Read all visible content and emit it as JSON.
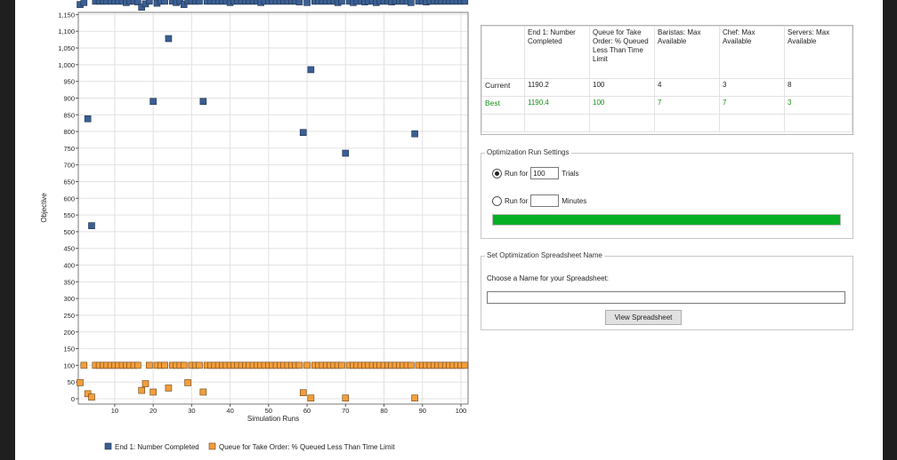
{
  "chart_data": {
    "type": "scatter",
    "xlabel": "Simulation Runs",
    "ylabel": "Objective",
    "xlim": [
      0,
      101
    ],
    "ylim": [
      0,
      1190
    ],
    "x_ticks": [
      10,
      20,
      30,
      40,
      50,
      60,
      70,
      80,
      90,
      100
    ],
    "y_ticks": [
      0,
      50,
      100,
      150,
      200,
      250,
      300,
      350,
      400,
      450,
      500,
      550,
      600,
      650,
      700,
      750,
      800,
      850,
      900,
      950,
      1000,
      1050,
      1100,
      1150
    ],
    "y_tick_labels": [
      "0",
      "50",
      "100",
      "150",
      "200",
      "250",
      "300",
      "350",
      "400",
      "450",
      "500",
      "550",
      "600",
      "650",
      "700",
      "750",
      "800",
      "850",
      "900",
      "950",
      "1,000",
      "1,050",
      "1,100",
      "1,150"
    ],
    "grid": true,
    "legend_position": "bottom",
    "series": [
      {
        "name": "End 1: Number Completed",
        "color": "#3a5f94",
        "points": [
          [
            1,
            1180
          ],
          [
            2,
            1186
          ],
          [
            3,
            838
          ],
          [
            4,
            518
          ],
          [
            5,
            1190
          ],
          [
            6,
            1190
          ],
          [
            7,
            1190
          ],
          [
            8,
            1190
          ],
          [
            9,
            1190
          ],
          [
            10,
            1190
          ],
          [
            11,
            1190
          ],
          [
            12,
            1190
          ],
          [
            13,
            1186
          ],
          [
            14,
            1190
          ],
          [
            15,
            1190
          ],
          [
            16,
            1188
          ],
          [
            17,
            1172
          ],
          [
            18,
            1182
          ],
          [
            19,
            1190
          ],
          [
            20,
            890
          ],
          [
            21,
            1184
          ],
          [
            22,
            1190
          ],
          [
            23,
            1190
          ],
          [
            24,
            1078
          ],
          [
            25,
            1190
          ],
          [
            26,
            1186
          ],
          [
            27,
            1190
          ],
          [
            28,
            1180
          ],
          [
            29,
            1190
          ],
          [
            30,
            1190
          ],
          [
            31,
            1190
          ],
          [
            32,
            1190
          ],
          [
            33,
            890
          ],
          [
            34,
            1190
          ],
          [
            35,
            1190
          ],
          [
            36,
            1190
          ],
          [
            37,
            1190
          ],
          [
            38,
            1190
          ],
          [
            39,
            1190
          ],
          [
            40,
            1186
          ],
          [
            41,
            1190
          ],
          [
            42,
            1190
          ],
          [
            43,
            1190
          ],
          [
            44,
            1190
          ],
          [
            45,
            1190
          ],
          [
            46,
            1190
          ],
          [
            47,
            1190
          ],
          [
            48,
            1186
          ],
          [
            49,
            1190
          ],
          [
            50,
            1190
          ],
          [
            51,
            1190
          ],
          [
            52,
            1190
          ],
          [
            53,
            1190
          ],
          [
            54,
            1190
          ],
          [
            55,
            1190
          ],
          [
            56,
            1190
          ],
          [
            57,
            1190
          ],
          [
            58,
            1188
          ],
          [
            59,
            797
          ],
          [
            60,
            1186
          ],
          [
            61,
            985
          ],
          [
            62,
            1190
          ],
          [
            63,
            1190
          ],
          [
            64,
            1190
          ],
          [
            65,
            1190
          ],
          [
            66,
            1190
          ],
          [
            67,
            1190
          ],
          [
            68,
            1186
          ],
          [
            69,
            1190
          ],
          [
            70,
            735
          ],
          [
            71,
            1190
          ],
          [
            72,
            1186
          ],
          [
            73,
            1190
          ],
          [
            74,
            1190
          ],
          [
            75,
            1188
          ],
          [
            76,
            1190
          ],
          [
            77,
            1190
          ],
          [
            78,
            1186
          ],
          [
            79,
            1190
          ],
          [
            80,
            1190
          ],
          [
            81,
            1190
          ],
          [
            82,
            1188
          ],
          [
            83,
            1190
          ],
          [
            84,
            1190
          ],
          [
            85,
            1190
          ],
          [
            86,
            1190
          ],
          [
            87,
            1186
          ],
          [
            88,
            793
          ],
          [
            89,
            1190
          ],
          [
            90,
            1190
          ],
          [
            91,
            1188
          ],
          [
            92,
            1190
          ],
          [
            93,
            1190
          ],
          [
            94,
            1190
          ],
          [
            95,
            1190
          ],
          [
            96,
            1190
          ],
          [
            97,
            1190
          ],
          [
            98,
            1190
          ],
          [
            99,
            1190
          ],
          [
            100,
            1190
          ],
          [
            101,
            1190
          ]
        ]
      },
      {
        "name": "Queue for Take Order: % Queued Less Than Time Limit",
        "color": "#f29e3c",
        "points": [
          [
            1,
            48
          ],
          [
            2,
            100
          ],
          [
            3,
            15
          ],
          [
            4,
            5
          ],
          [
            5,
            100
          ],
          [
            6,
            100
          ],
          [
            7,
            100
          ],
          [
            8,
            100
          ],
          [
            9,
            100
          ],
          [
            10,
            100
          ],
          [
            11,
            100
          ],
          [
            12,
            100
          ],
          [
            13,
            100
          ],
          [
            14,
            100
          ],
          [
            15,
            100
          ],
          [
            16,
            100
          ],
          [
            17,
            25
          ],
          [
            18,
            45
          ],
          [
            19,
            100
          ],
          [
            20,
            20
          ],
          [
            21,
            100
          ],
          [
            22,
            100
          ],
          [
            23,
            100
          ],
          [
            24,
            32
          ],
          [
            25,
            100
          ],
          [
            26,
            100
          ],
          [
            27,
            100
          ],
          [
            28,
            100
          ],
          [
            29,
            48
          ],
          [
            30,
            100
          ],
          [
            31,
            100
          ],
          [
            32,
            100
          ],
          [
            33,
            20
          ],
          [
            34,
            100
          ],
          [
            35,
            100
          ],
          [
            36,
            100
          ],
          [
            37,
            100
          ],
          [
            38,
            100
          ],
          [
            39,
            100
          ],
          [
            40,
            100
          ],
          [
            41,
            100
          ],
          [
            42,
            100
          ],
          [
            43,
            100
          ],
          [
            44,
            100
          ],
          [
            45,
            100
          ],
          [
            46,
            100
          ],
          [
            47,
            100
          ],
          [
            48,
            100
          ],
          [
            49,
            100
          ],
          [
            50,
            100
          ],
          [
            51,
            100
          ],
          [
            52,
            100
          ],
          [
            53,
            100
          ],
          [
            54,
            100
          ],
          [
            55,
            100
          ],
          [
            56,
            100
          ],
          [
            57,
            100
          ],
          [
            58,
            100
          ],
          [
            59,
            18
          ],
          [
            60,
            100
          ],
          [
            61,
            2
          ],
          [
            62,
            100
          ],
          [
            63,
            100
          ],
          [
            64,
            100
          ],
          [
            65,
            100
          ],
          [
            66,
            100
          ],
          [
            67,
            100
          ],
          [
            68,
            100
          ],
          [
            69,
            100
          ],
          [
            70,
            2
          ],
          [
            71,
            100
          ],
          [
            72,
            100
          ],
          [
            73,
            100
          ],
          [
            74,
            100
          ],
          [
            75,
            100
          ],
          [
            76,
            100
          ],
          [
            77,
            100
          ],
          [
            78,
            100
          ],
          [
            79,
            100
          ],
          [
            80,
            100
          ],
          [
            81,
            100
          ],
          [
            82,
            100
          ],
          [
            83,
            100
          ],
          [
            84,
            100
          ],
          [
            85,
            100
          ],
          [
            86,
            100
          ],
          [
            87,
            100
          ],
          [
            88,
            2
          ],
          [
            89,
            100
          ],
          [
            90,
            100
          ],
          [
            91,
            100
          ],
          [
            92,
            100
          ],
          [
            93,
            100
          ],
          [
            94,
            100
          ],
          [
            95,
            100
          ],
          [
            96,
            100
          ],
          [
            97,
            100
          ],
          [
            98,
            100
          ],
          [
            99,
            100
          ],
          [
            100,
            100
          ],
          [
            101,
            100
          ]
        ]
      }
    ]
  },
  "results_table": {
    "columns": [
      "End 1: Number Completed",
      "Queue for Take Order: % Queued Less Than Time Limit",
      "Baristas: Max Available",
      "Chef: Max Available",
      "Servers: Max Available"
    ],
    "rows": [
      {
        "label": "Current",
        "values": [
          "1190.2",
          "100",
          "4",
          "3",
          "8"
        ]
      },
      {
        "label": "Best",
        "values": [
          "1190.4",
          "100",
          "7",
          "7",
          "3"
        ]
      }
    ]
  },
  "run_settings": {
    "title": "Optimization Run Settings",
    "run_for_label": "Run for",
    "trials_value": "100",
    "trials_unit": "Trials",
    "minutes_value": "",
    "minutes_unit": "Minutes",
    "selected": "trials",
    "progress": 1.0,
    "progress_color": "#06b025"
  },
  "spreadsheet": {
    "title": "Set Optimization Spreadsheet Name",
    "prompt": "Choose a Name for your Spreadsheet:",
    "name_value": "",
    "button_label": "View Spreadsheet"
  }
}
